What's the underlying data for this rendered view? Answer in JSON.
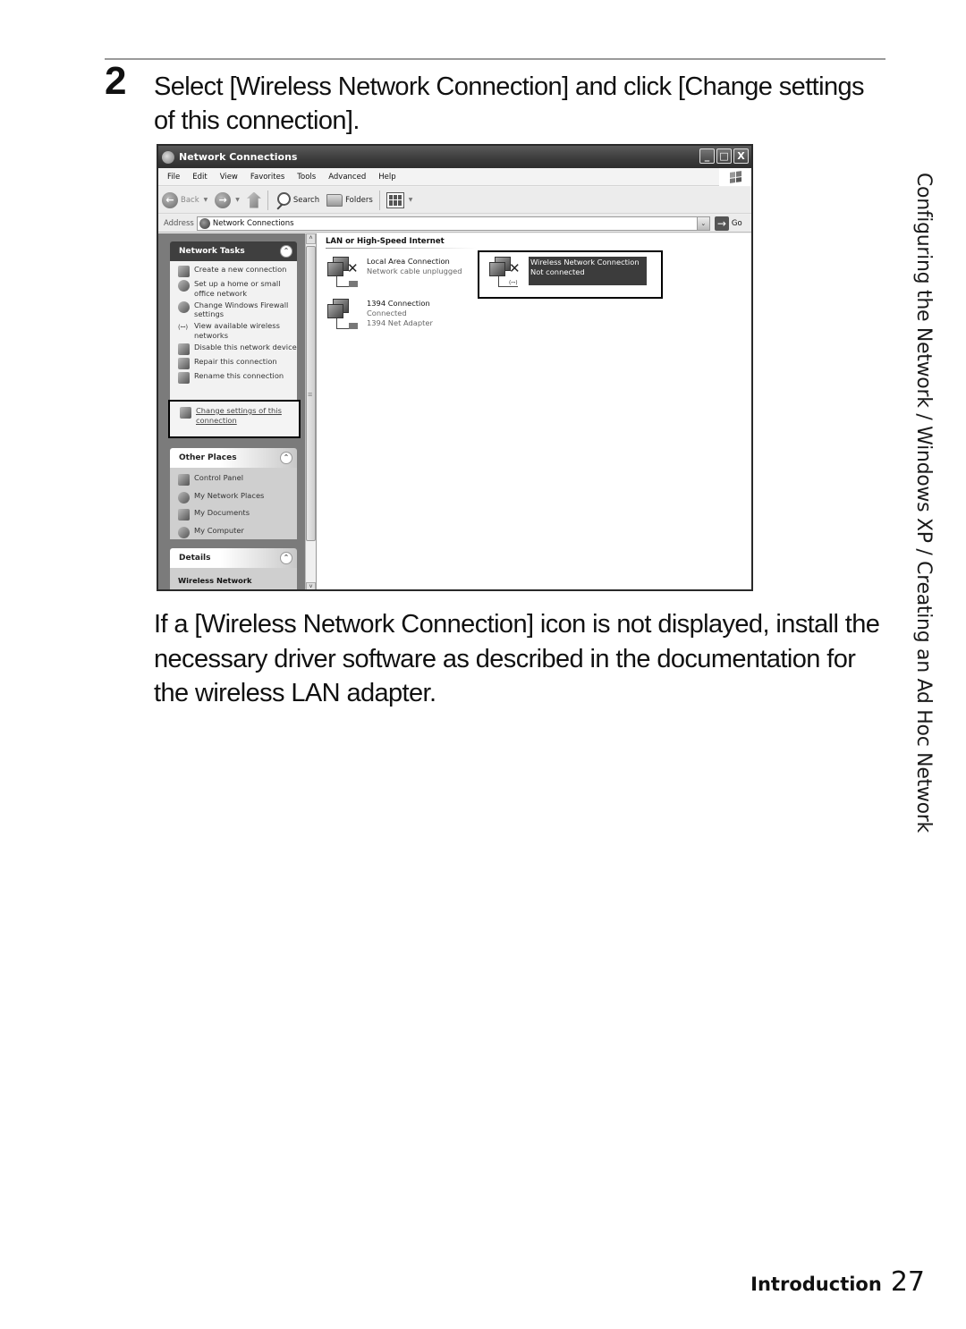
{
  "page": {
    "step_number": "2",
    "step_instruction": "Select [Wireless Network Connection] and click [Change settings of this connection].",
    "note": "If a [Wireless Network Connection] icon is not displayed, install the necessary driver software as described in the documentation for the wireless LAN adapter.",
    "side_title": "Configuring the Network / Windows XP / Creating an Ad Hoc Network",
    "footer": {
      "section": "Introduction",
      "page_number": "27"
    }
  },
  "window": {
    "title": "Network Connections",
    "controls": {
      "minimize": "_",
      "maximize": "□",
      "close": "X"
    },
    "menu": [
      "File",
      "Edit",
      "View",
      "Favorites",
      "Tools",
      "Advanced",
      "Help"
    ],
    "toolbar": {
      "back": "Back",
      "search": "Search",
      "folders": "Folders"
    },
    "address": {
      "label": "Address",
      "value": "Network Connections",
      "go": "Go"
    },
    "task_pane": {
      "network_tasks": {
        "title": "Network Tasks",
        "items": [
          "Create a new connection",
          "Set up a home or small office network",
          "Change Windows Firewall settings",
          "View available wireless networks",
          "Disable this network device",
          "Repair this connection",
          "Rename this connection",
          "Change settings of this connection"
        ]
      },
      "other_places": {
        "title": "Other Places",
        "items": [
          "Control Panel",
          "My Network Places",
          "My Documents",
          "My Computer"
        ]
      },
      "details": {
        "title": "Details",
        "first_line": "Wireless Network"
      }
    },
    "content": {
      "group": "LAN or High-Speed Internet",
      "connections": [
        {
          "name": "Local Area Connection",
          "status": "Network cable unplugged",
          "device": ""
        },
        {
          "name": "Wireless Network Connection",
          "status": "Not connected",
          "device": "",
          "selected": true
        },
        {
          "name": "1394 Connection",
          "status": "Connected",
          "device": "1394 Net Adapter"
        }
      ]
    }
  }
}
